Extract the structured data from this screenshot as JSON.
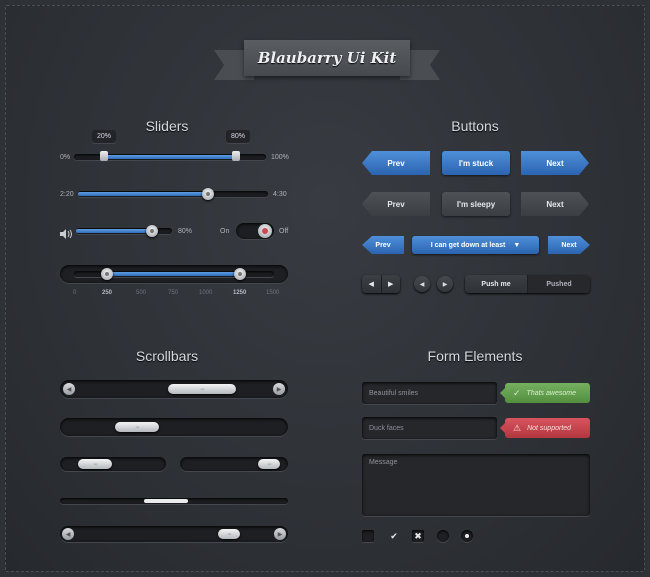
{
  "kit_title": "Blaubarry Ui Kit",
  "sections": {
    "sliders": "Sliders",
    "buttons": "Buttons",
    "scrollbars": "Scrollbars",
    "form_elements": "Form Elements"
  },
  "sliders": {
    "range": {
      "min_label": "0%",
      "max_label": "100%",
      "low_tip": "20%",
      "high_tip": "80%",
      "low": 0.2,
      "high": 0.8
    },
    "time": {
      "start": "2:20",
      "end": "4:30",
      "progress": 0.7
    },
    "volume": {
      "icon": "speaker-icon",
      "value_label": "80%",
      "value": 0.8
    },
    "toggle": {
      "on_label": "On",
      "off_label": "Off",
      "state": "off"
    },
    "ticks": {
      "labels": [
        "0",
        "250",
        "500",
        "750",
        "1000",
        "1250",
        "1500"
      ],
      "low": 250,
      "high": 1250
    }
  },
  "buttons": {
    "row1": {
      "prev": "Prev",
      "middle": "I'm stuck",
      "next": "Next"
    },
    "row2": {
      "prev": "Prev",
      "middle": "I'm sleepy",
      "next": "Next"
    },
    "row3": {
      "prev": "Prev",
      "dropdown": "I can get down at least",
      "next": "Next"
    },
    "segmented": {
      "pressed": "Push me",
      "other": "Pushed"
    }
  },
  "scrollbars": {
    "thumb_grip": "···"
  },
  "form": {
    "field1": {
      "value": "Beautiful smiles",
      "status": "Thats awesome"
    },
    "field2": {
      "value": "Duck faces",
      "status": "Not supported"
    },
    "message_placeholder": "Message"
  },
  "colors": {
    "accent": "#3a78c6",
    "success": "#66a151",
    "error": "#c8454f",
    "background": "#2e3136"
  }
}
